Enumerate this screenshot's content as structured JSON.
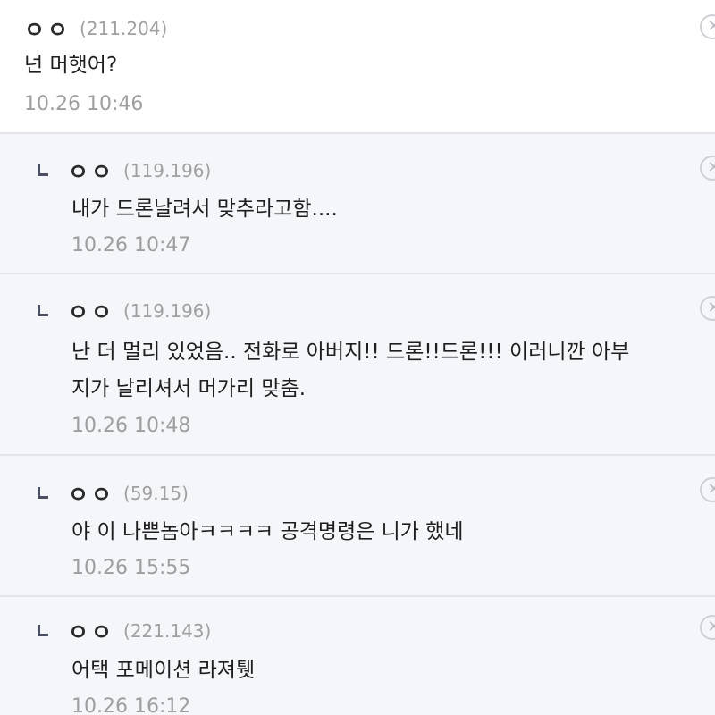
{
  "comments": [
    {
      "nickname": "ㅇㅇ",
      "ip": "(211.204)",
      "text": "넌 머햇어?",
      "time": "10.26 10:46",
      "is_reply": false
    },
    {
      "nickname": "ㅇㅇ",
      "ip": "(119.196)",
      "text": "내가 드론날려서 맞추라고함....",
      "time": "10.26 10:47",
      "is_reply": true
    },
    {
      "nickname": "ㅇㅇ",
      "ip": "(119.196)",
      "text_line1": "난 더 멀리 있었음.. 전화로 아버지!! 드론!!드론!!! 이러니깐 아부",
      "text_line2": "지가 날리셔서 머가리 맞춤.",
      "time": "10.26 10:48",
      "is_reply": true
    },
    {
      "nickname": "ㅇㅇ",
      "ip": "(59.15)",
      "text": "야 이 나쁜놈아ㅋㅋㅋㅋ 공격명령은 니가 했네",
      "time": "10.26 15:55",
      "is_reply": true
    },
    {
      "nickname": "ㅇㅇ",
      "ip": "(221.143)",
      "text": "어택 포메이션 라져퉷",
      "time": "10.26 16:12",
      "is_reply": true
    }
  ],
  "delete_icon": "close-circle-icon",
  "reply_icon": "reply-arrow-icon"
}
